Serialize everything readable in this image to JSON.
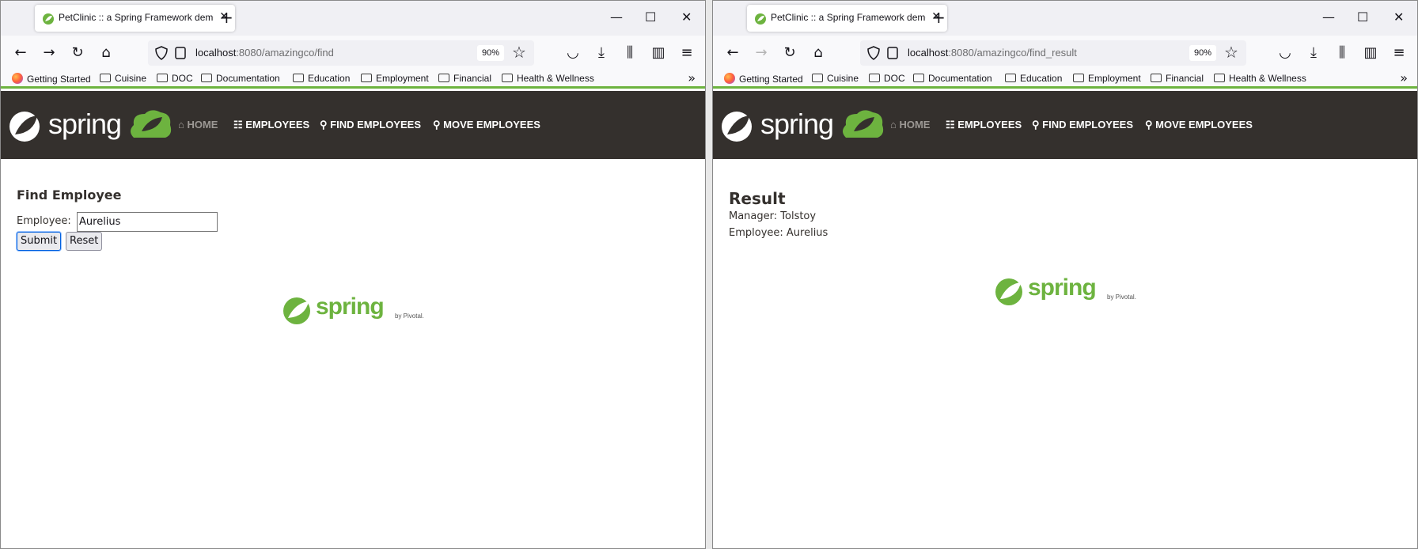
{
  "windows": [
    {
      "tab_title": "PetClinic :: a Spring Framework demonstration",
      "url_host": "localhost",
      "url_rest": ":8080/amazingco/find",
      "zoom": "90%",
      "page": "find"
    },
    {
      "tab_title": "PetClinic :: a Spring Framework demonstration",
      "url_host": "localhost",
      "url_rest": ":8080/amazingco/find_result",
      "zoom": "90%",
      "page": "result"
    }
  ],
  "bookmarks": [
    "Getting Started",
    "Cuisine",
    "DOC",
    "Documentation",
    "Education",
    "Employment",
    "Financial",
    "Health & Wellness"
  ],
  "brand": {
    "logo_text": "spring",
    "footer_logo_text": "spring",
    "footer_by": "by Pivotal.",
    "accent": "#6db33f",
    "nav_bg": "#34302d"
  },
  "menu": {
    "home": "HOME",
    "employees": "EMPLOYEES",
    "find": "FIND EMPLOYEES",
    "move": "MOVE EMPLOYEES"
  },
  "find_form": {
    "title": "Find Employee",
    "employee_label": "Employee:",
    "employee_value": "Aurelius",
    "submit_label": "Submit",
    "reset_label": "Reset"
  },
  "result": {
    "title": "Result",
    "manager_line": "Manager: Tolstoy",
    "employee_line": "Employee: Aurelius"
  },
  "icons": {
    "back": "back-arrow-icon",
    "forward": "forward-arrow-icon",
    "reload": "reload-icon",
    "home": "home-icon",
    "shield": "shield-icon",
    "star": "bookmark-star-icon",
    "pocket": "pocket-icon",
    "download": "download-icon",
    "library": "library-icon",
    "sidebar": "sidebar-icon",
    "menu": "hamburger-menu-icon"
  }
}
